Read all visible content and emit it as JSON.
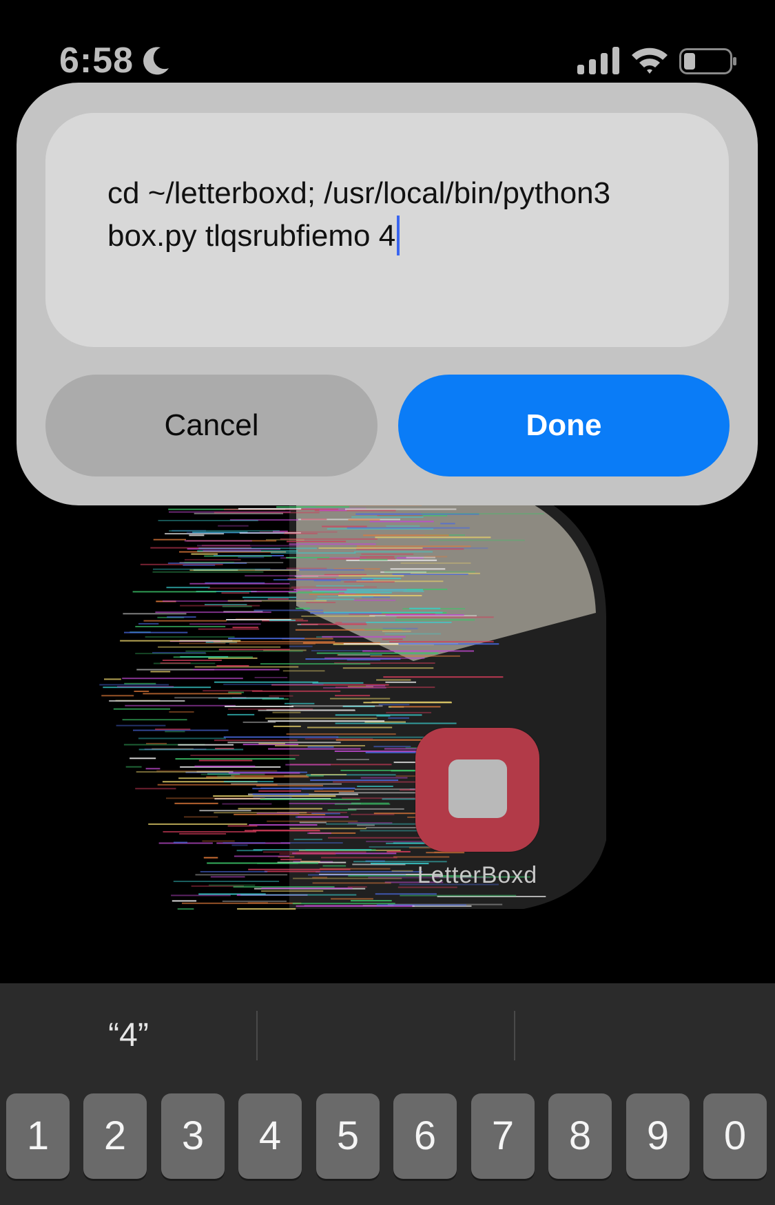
{
  "status_bar": {
    "time": "6:58",
    "icons": [
      "moon-icon",
      "signal-icon",
      "wifi-icon",
      "battery-icon"
    ]
  },
  "dialog": {
    "text_value": "cd ~/letterboxd; /usr/local/bin/python3 box.py tlqsrubfiemo 4",
    "text_line1": "cd ~/letterboxd; /usr/local/bin/python3",
    "text_line2": "box.py tlqsrubfiemo 4",
    "cancel_label": "Cancel",
    "done_label": "Done",
    "colors": {
      "done": "#0a7cf7",
      "caret": "#3a66f0"
    }
  },
  "home": {
    "app_label": "LetterBoxd",
    "app_color": "#b23a48"
  },
  "keyboard": {
    "suggestions": [
      "“4”",
      "",
      ""
    ],
    "keys": [
      "1",
      "2",
      "3",
      "4",
      "5",
      "6",
      "7",
      "8",
      "9",
      "0"
    ]
  }
}
